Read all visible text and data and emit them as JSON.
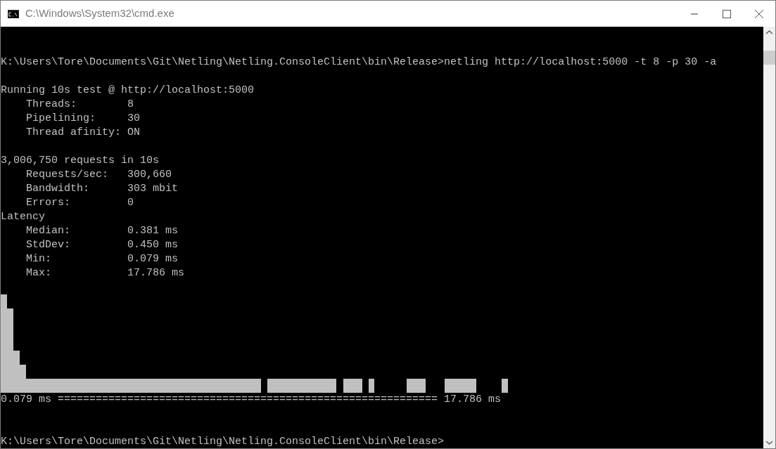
{
  "window": {
    "title": "C:\\Windows\\System32\\cmd.exe"
  },
  "console": [
    {
      "kind": "command",
      "lines": [
        "K:\\Users\\Tore\\Documents\\Git\\Netling\\Netling.ConsoleClient\\bin\\Release>netling http://localhost:5000 -t 8 -p 30 -a"
      ]
    },
    {
      "kind": "output",
      "lines": [
        "Running 10s test @ http://localhost:5000",
        "    Threads:        8",
        "    Pipelining:     30",
        "    Thread afinity: ON"
      ]
    },
    {
      "kind": "output",
      "lines": [
        "3,006,750 requests in 10s",
        "    Requests/sec:   300,660",
        "    Bandwidth:      303 mbit",
        "    Errors:         0",
        "Latency",
        "    Median:         0.381 ms",
        "    StdDev:         0.450 ms",
        "    Min:            0.079 ms",
        "    Max:            17.786 ms"
      ]
    },
    {
      "kind": "histogram",
      "lines": [
        "0.079 ms ============================================================ 17.786 ms"
      ]
    },
    {
      "kind": "prompt",
      "lines": [
        "K:\\Users\\Tore\\Documents\\Git\\Netling\\Netling.ConsoleClient\\bin\\Release>"
      ]
    }
  ]
}
